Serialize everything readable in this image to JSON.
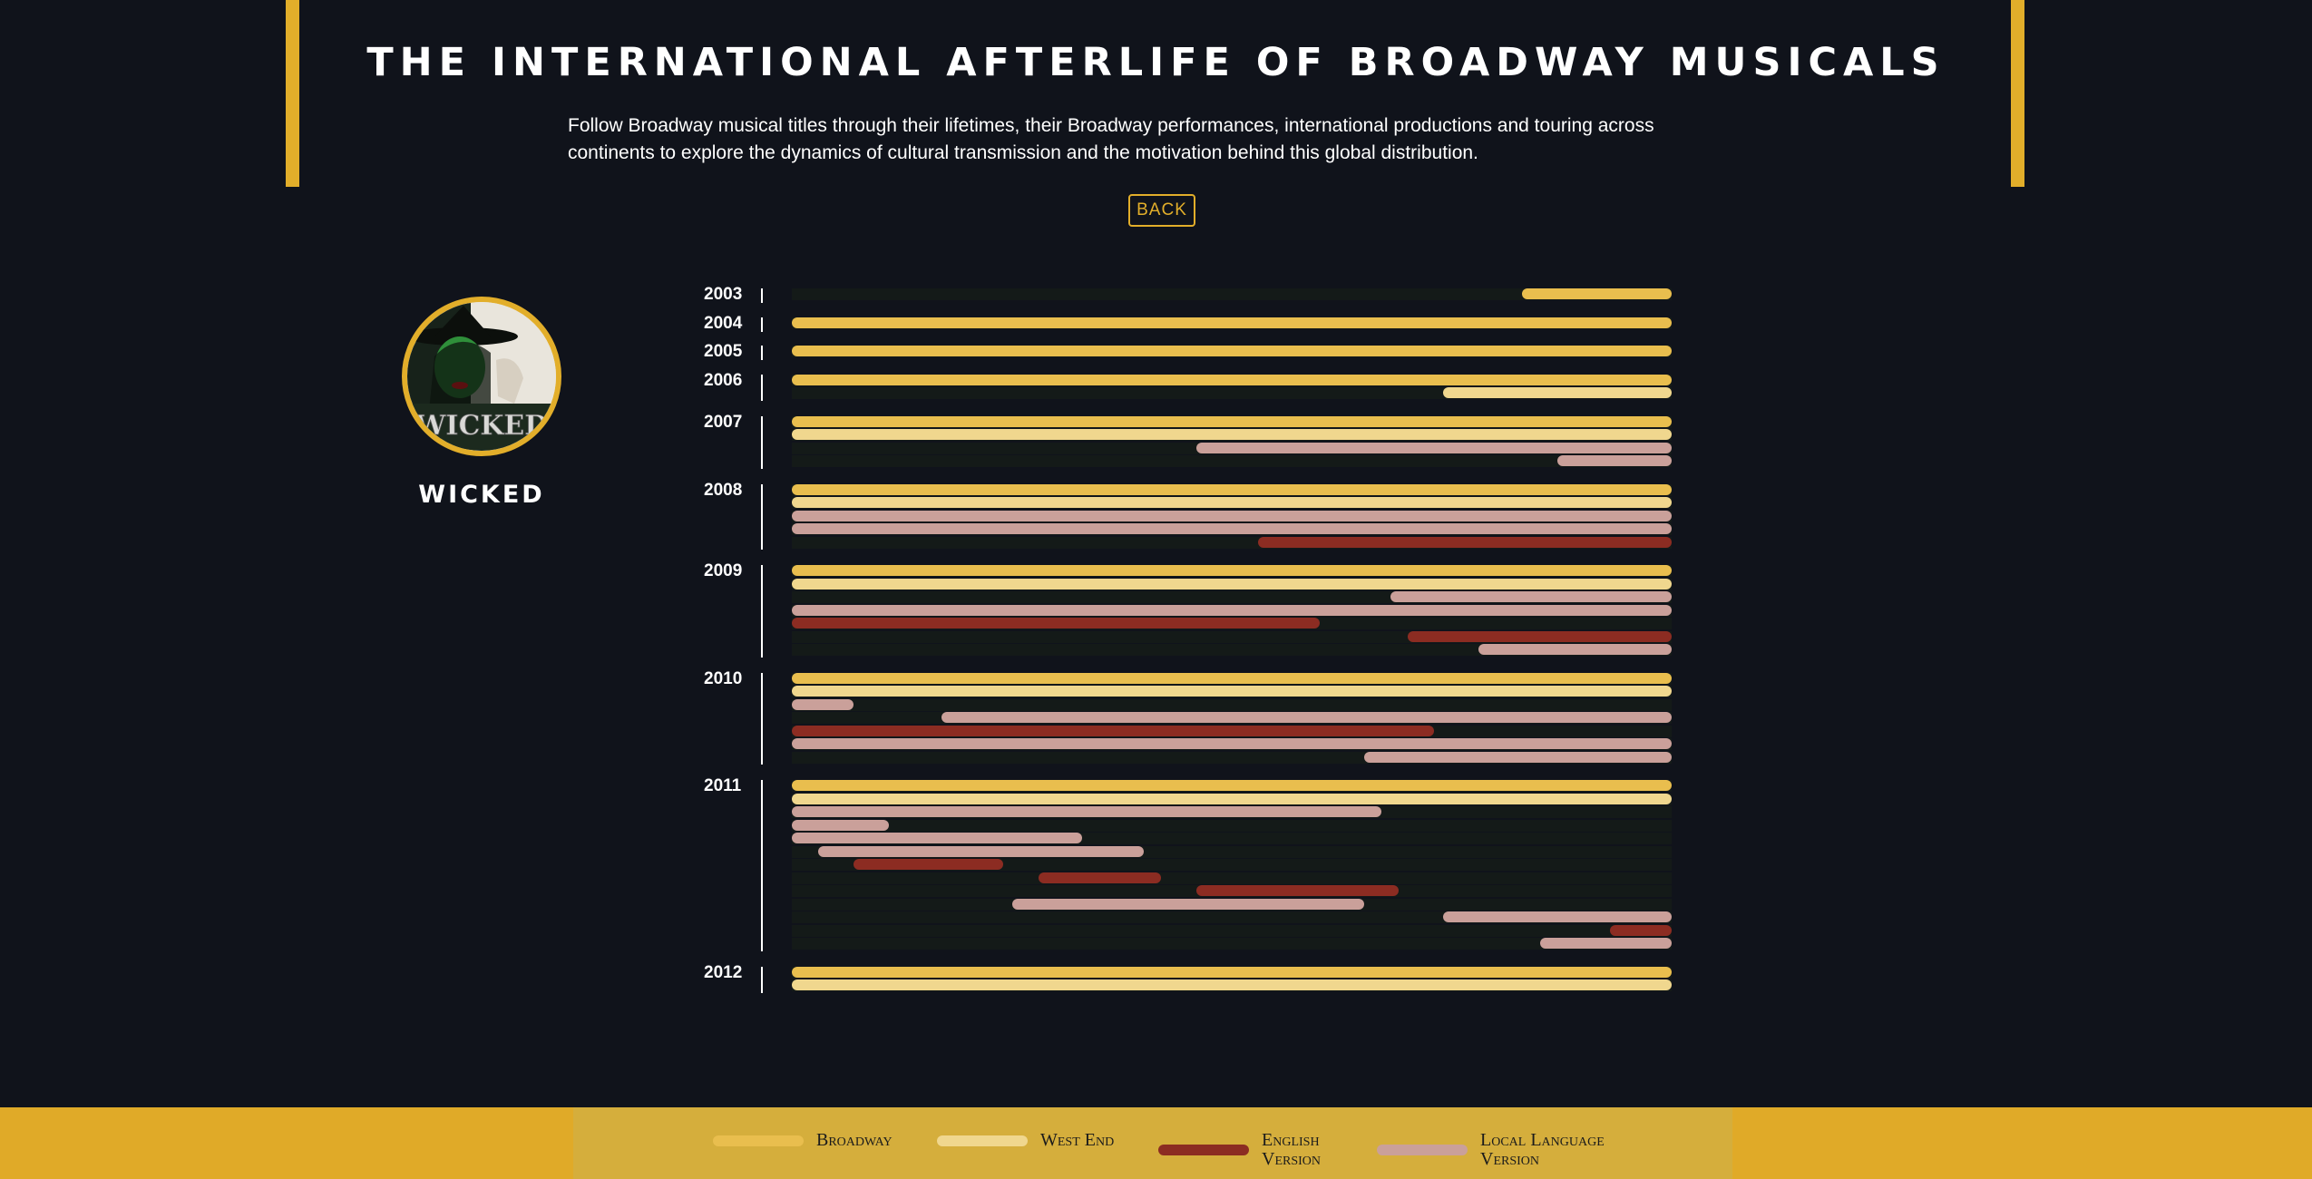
{
  "header": {
    "title": "THE INTERNATIONAL AFTERLIFE OF BROADWAY MUSICALS",
    "subtitle": "Follow Broadway musical titles through their lifetimes, their Broadway performances, international productions and touring across continents to explore the dynamics of cultural transmission and the motivation behind this global distribution.",
    "back_label": "BACK"
  },
  "show": {
    "title": "WICKED",
    "poster_text": "WICKED"
  },
  "colors": {
    "broadway": "#e9be4e",
    "west_end": "#f0d78e",
    "english": "#8c2c22",
    "local": "#caa09a",
    "accent": "#e2ae2a"
  },
  "legend": [
    {
      "key": "broadway",
      "label": "Broadway"
    },
    {
      "key": "west_end",
      "label": "West End"
    },
    {
      "key": "english",
      "label": "English\nVersion"
    },
    {
      "key": "local",
      "label": "Local Language\nVersion"
    }
  ],
  "chart_data": {
    "type": "timeline",
    "title": "",
    "xlabel": "",
    "ylabel": "",
    "x_unit": "fraction of year",
    "categories": [
      "Broadway",
      "West End",
      "English Version",
      "Local Language Version"
    ],
    "years": [
      {
        "year": "2003",
        "bars": [
          {
            "category": "broadway",
            "start": 0.83,
            "end": 1.0
          }
        ]
      },
      {
        "year": "2004",
        "bars": [
          {
            "category": "broadway",
            "start": 0.0,
            "end": 1.0
          }
        ]
      },
      {
        "year": "2005",
        "bars": [
          {
            "category": "broadway",
            "start": 0.0,
            "end": 1.0
          }
        ]
      },
      {
        "year": "2006",
        "bars": [
          {
            "category": "broadway",
            "start": 0.0,
            "end": 1.0
          },
          {
            "category": "west_end",
            "start": 0.74,
            "end": 1.0
          }
        ]
      },
      {
        "year": "2007",
        "bars": [
          {
            "category": "broadway",
            "start": 0.0,
            "end": 1.0
          },
          {
            "category": "west_end",
            "start": 0.0,
            "end": 1.0
          },
          {
            "category": "local",
            "start": 0.46,
            "end": 1.0
          },
          {
            "category": "local",
            "start": 0.87,
            "end": 1.0
          }
        ]
      },
      {
        "year": "2008",
        "bars": [
          {
            "category": "broadway",
            "start": 0.0,
            "end": 1.0
          },
          {
            "category": "west_end",
            "start": 0.0,
            "end": 1.0
          },
          {
            "category": "local",
            "start": 0.0,
            "end": 1.0
          },
          {
            "category": "local",
            "start": 0.0,
            "end": 1.0
          },
          {
            "category": "english",
            "start": 0.53,
            "end": 1.0
          }
        ]
      },
      {
        "year": "2009",
        "bars": [
          {
            "category": "broadway",
            "start": 0.0,
            "end": 1.0
          },
          {
            "category": "west_end",
            "start": 0.0,
            "end": 1.0
          },
          {
            "category": "local",
            "start": 0.68,
            "end": 1.0
          },
          {
            "category": "local",
            "start": 0.0,
            "end": 1.0
          },
          {
            "category": "english",
            "start": 0.0,
            "end": 0.6
          },
          {
            "category": "english",
            "start": 0.7,
            "end": 1.0
          },
          {
            "category": "local",
            "start": 0.78,
            "end": 1.0
          }
        ]
      },
      {
        "year": "2010",
        "bars": [
          {
            "category": "broadway",
            "start": 0.0,
            "end": 1.0
          },
          {
            "category": "west_end",
            "start": 0.0,
            "end": 1.0
          },
          {
            "category": "local",
            "start": 0.0,
            "end": 0.07
          },
          {
            "category": "local",
            "start": 0.17,
            "end": 1.0
          },
          {
            "category": "english",
            "start": 0.0,
            "end": 0.73
          },
          {
            "category": "local",
            "start": 0.0,
            "end": 1.0
          },
          {
            "category": "local",
            "start": 0.65,
            "end": 1.0
          }
        ]
      },
      {
        "year": "2011",
        "bars": [
          {
            "category": "broadway",
            "start": 0.0,
            "end": 1.0
          },
          {
            "category": "west_end",
            "start": 0.0,
            "end": 1.0
          },
          {
            "category": "local",
            "start": 0.0,
            "end": 0.67
          },
          {
            "category": "local",
            "start": 0.0,
            "end": 0.11
          },
          {
            "category": "local",
            "start": 0.0,
            "end": 0.33
          },
          {
            "category": "local",
            "start": 0.03,
            "end": 0.4
          },
          {
            "category": "english",
            "start": 0.07,
            "end": 0.24
          },
          {
            "category": "english",
            "start": 0.28,
            "end": 0.42
          },
          {
            "category": "english",
            "start": 0.46,
            "end": 0.69
          },
          {
            "category": "local",
            "start": 0.25,
            "end": 0.65
          },
          {
            "category": "local",
            "start": 0.74,
            "end": 1.0
          },
          {
            "category": "english",
            "start": 0.93,
            "end": 1.0
          },
          {
            "category": "local",
            "start": 0.85,
            "end": 1.0
          }
        ]
      },
      {
        "year": "2012",
        "bars": [
          {
            "category": "broadway",
            "start": 0.0,
            "end": 1.0
          },
          {
            "category": "west_end",
            "start": 0.0,
            "end": 1.0
          }
        ]
      }
    ]
  }
}
